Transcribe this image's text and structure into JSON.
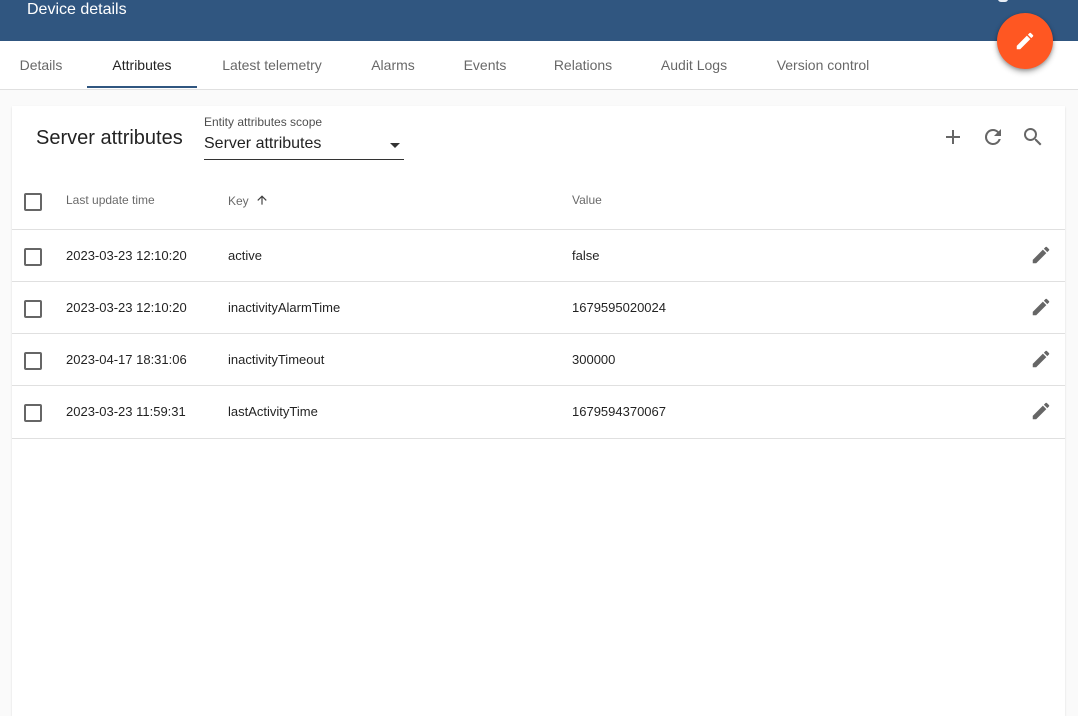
{
  "header": {
    "title": "Device details"
  },
  "tabs": [
    {
      "label": "Details"
    },
    {
      "label": "Attributes"
    },
    {
      "label": "Latest telemetry"
    },
    {
      "label": "Alarms"
    },
    {
      "label": "Events"
    },
    {
      "label": "Relations"
    },
    {
      "label": "Audit Logs"
    },
    {
      "label": "Version control"
    }
  ],
  "active_tab": "Attributes",
  "card": {
    "title": "Server attributes",
    "scope_label": "Entity attributes scope",
    "scope_value": "Server attributes"
  },
  "table": {
    "columns": {
      "last_update_time": "Last update time",
      "key": "Key",
      "value": "Value"
    },
    "sort": {
      "column": "Key",
      "direction": "ascending"
    },
    "rows": [
      {
        "time": "2023-03-23 12:10:20",
        "key": "active",
        "value": "false"
      },
      {
        "time": "2023-03-23 12:10:20",
        "key": "inactivityAlarmTime",
        "value": "1679595020024"
      },
      {
        "time": "2023-04-17 18:31:06",
        "key": "inactivityTimeout",
        "value": "300000"
      },
      {
        "time": "2023-03-23 11:59:31",
        "key": "lastActivityTime",
        "value": "1679594370067"
      }
    ]
  },
  "icons": {
    "fab": "edit-icon",
    "add": "add-icon",
    "refresh": "refresh-icon",
    "search": "search-icon",
    "row_edit": "edit-icon",
    "sort": "arrow-up-icon"
  },
  "colors": {
    "header_bg": "#305680",
    "fab_bg": "#ff5722",
    "ink_bar": "#305680"
  }
}
